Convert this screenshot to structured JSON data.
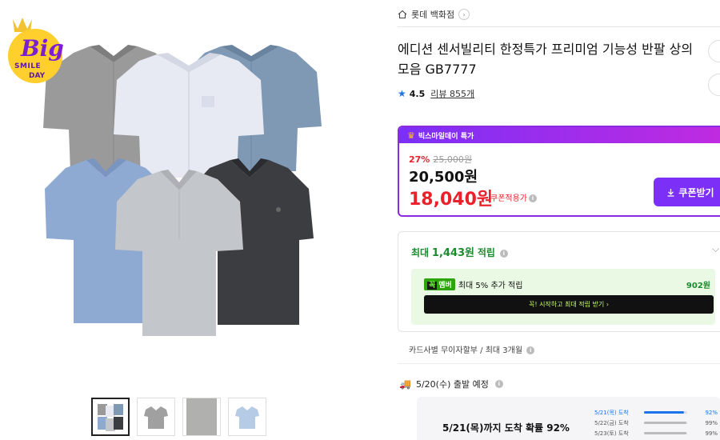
{
  "badge": {
    "line1": "Big",
    "line2": "SMILE",
    "line3": "DAY"
  },
  "store": {
    "name": "롯데 백화점"
  },
  "product": {
    "title": "에디션 센서빌리티 한정특가 프리미엄 기능성 반팔 상의 모음 GB7777",
    "rating": "4.5",
    "review_label": "리뷰 855개"
  },
  "promo": {
    "header": "빅스마일데이 특가",
    "discount_pct": "27%",
    "original_price": "25,000원",
    "sale_price": "20,500원",
    "coupon_price": "18,040원",
    "coupon_label": "쿠폰적용가",
    "coupon_button": "쿠폰받기"
  },
  "points": {
    "prefix": "최대",
    "amount": "1,443원",
    "suffix": "적립",
    "member_tag_k": "꼭",
    "member_tag": "멤버",
    "member_text": "최대 5% 추가 적립",
    "member_amount": "902원",
    "member_button": "꼭! 시작하고 최대 적립 받기 ›"
  },
  "installment": "카드사별 무이자할부 / 최대 3개월",
  "shipping": {
    "departure": "5/20(수) 출발 예정",
    "arrival_main": "5/21(목)까지 도착 확률 92%",
    "rows": [
      {
        "date": "5/21(목) 도착",
        "pct": "92%",
        "value": 0.92,
        "highlight": true
      },
      {
        "date": "5/22(금) 도착",
        "pct": "99%",
        "value": 0.99,
        "highlight": false
      },
      {
        "date": "5/23(토) 도착",
        "pct": "99%",
        "value": 0.99,
        "highlight": false
      }
    ]
  },
  "colors": {
    "accent_purple": "#7b2ff7",
    "sale_red": "#e8212b",
    "points_green": "#1c8b2e",
    "rating_blue": "#1a73e8"
  },
  "thumbnails": [
    {
      "name": "thumb-all-colors"
    },
    {
      "name": "thumb-gray-shirt"
    },
    {
      "name": "thumb-fabric-detail"
    },
    {
      "name": "thumb-blue-shirt"
    }
  ]
}
